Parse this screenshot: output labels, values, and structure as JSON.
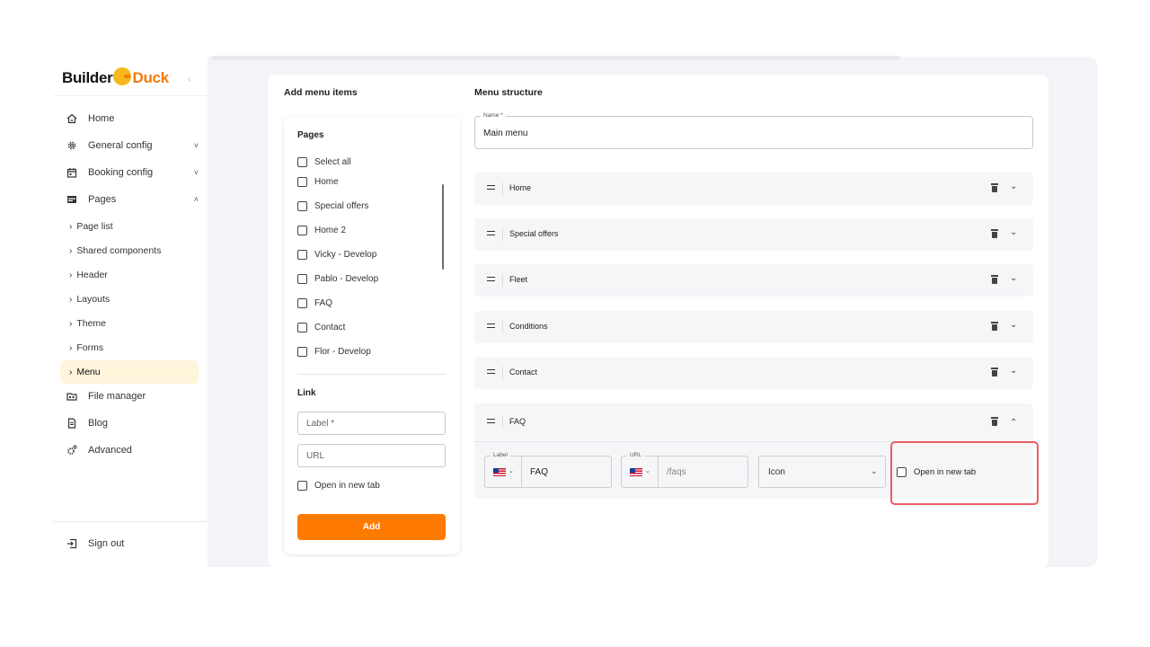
{
  "brand": {
    "part1": "Builder",
    "part2": "Duck",
    "duck_color": "#f6b81c",
    "accent": "#f47a0a"
  },
  "sidebar": {
    "collapse_icon": "chevron-left-icon",
    "items": [
      {
        "label": "Home",
        "icon": "home-icon"
      },
      {
        "label": "General config",
        "icon": "gear-icon",
        "chevron": "˅"
      },
      {
        "label": "Booking config",
        "icon": "calendar-icon",
        "chevron": "˅"
      },
      {
        "label": "Pages",
        "icon": "pages-icon",
        "chevron": "˄"
      }
    ],
    "sub_items": [
      {
        "label": "Page list"
      },
      {
        "label": "Shared components"
      },
      {
        "label": "Header"
      },
      {
        "label": "Layouts"
      },
      {
        "label": "Theme"
      },
      {
        "label": "Forms"
      },
      {
        "label": "Menu",
        "active": true
      }
    ],
    "bottom_items": [
      {
        "label": "File manager",
        "icon": "folder-icon"
      },
      {
        "label": "Blog",
        "icon": "document-icon"
      },
      {
        "label": "Advanced",
        "icon": "advanced-gear-icon"
      }
    ],
    "sign_out": {
      "label": "Sign out",
      "icon": "sign-out-icon"
    },
    "active_bg": "#fff5db"
  },
  "add_menu_items": {
    "heading": "Add menu items",
    "pages": {
      "title": "Pages",
      "select_all": "Select all",
      "items": [
        "Home",
        "Special offers",
        "Home 2",
        "Vicky - Develop",
        "Pablo - Develop",
        "FAQ",
        "Contact",
        "Flor - Develop"
      ]
    },
    "link": {
      "title": "Link",
      "label_placeholder": "Label *",
      "url_placeholder": "URL",
      "open_new_tab": "Open in new tab"
    },
    "add_button": "Add",
    "add_button_color": "#ff7a00"
  },
  "menu_structure": {
    "heading": "Menu structure",
    "name_legend": "Name *",
    "name_value": "Main menu",
    "rows": [
      {
        "label": "Home"
      },
      {
        "label": "Special offers"
      },
      {
        "label": "Fleet"
      },
      {
        "label": "Conditions"
      },
      {
        "label": "Contact"
      }
    ],
    "expanded_row": {
      "label": "FAQ",
      "label_field": {
        "legend": "Label",
        "value": "FAQ"
      },
      "url_field": {
        "legend": "URL",
        "placeholder": "/faqs"
      },
      "icon_select": "Icon",
      "open_new_tab": "Open in new tab",
      "highlight_color": "#ec5c63"
    }
  }
}
